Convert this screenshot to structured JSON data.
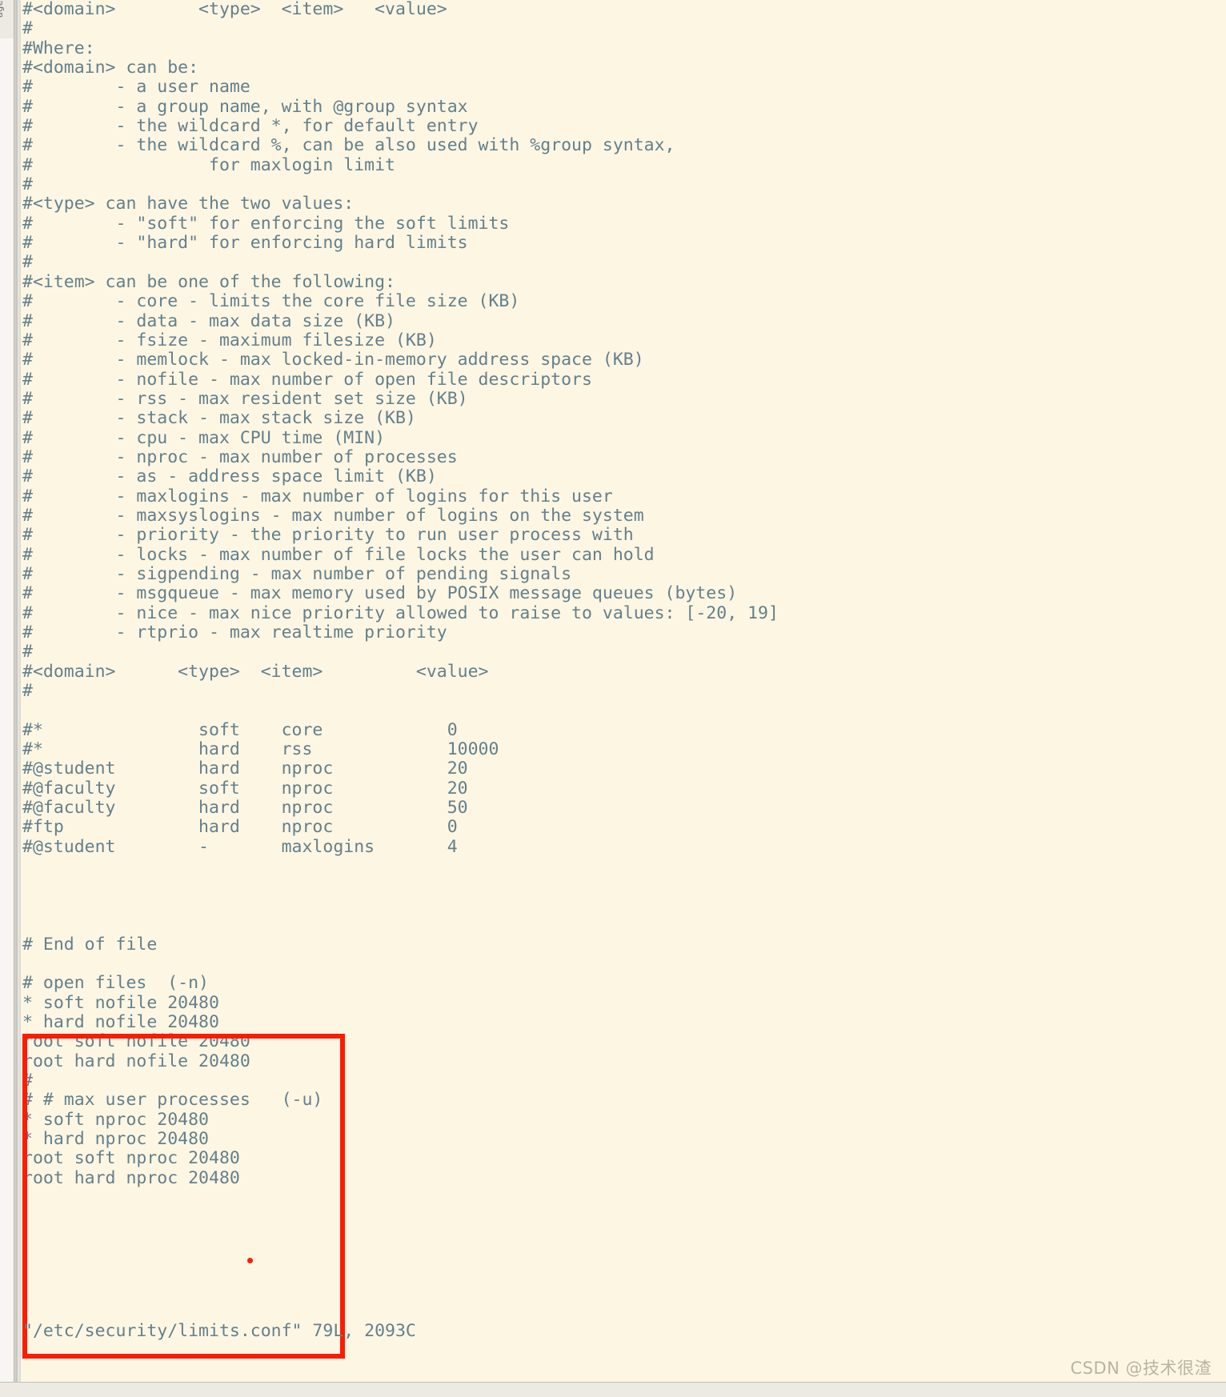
{
  "window": {
    "side_tab_label": "ager"
  },
  "editor": {
    "kind": "vim",
    "colors": {
      "background": "#fdf6e3",
      "foreground": "#63808c",
      "annotation": "#ff1b00",
      "chrome": "#eceae3",
      "watermark": "#b9b3a4"
    },
    "file_content": "#<domain>        <type>  <item>   <value>\n#\n#Where:\n#<domain> can be:\n#        - a user name\n#        - a group name, with @group syntax\n#        - the wildcard *, for default entry\n#        - the wildcard %, can be also used with %group syntax,\n#                 for maxlogin limit\n#\n#<type> can have the two values:\n#        - \"soft\" for enforcing the soft limits\n#        - \"hard\" for enforcing hard limits\n#\n#<item> can be one of the following:\n#        - core - limits the core file size (KB)\n#        - data - max data size (KB)\n#        - fsize - maximum filesize (KB)\n#        - memlock - max locked-in-memory address space (KB)\n#        - nofile - max number of open file descriptors\n#        - rss - max resident set size (KB)\n#        - stack - max stack size (KB)\n#        - cpu - max CPU time (MIN)\n#        - nproc - max number of processes\n#        - as - address space limit (KB)\n#        - maxlogins - max number of logins for this user\n#        - maxsyslogins - max number of logins on the system\n#        - priority - the priority to run user process with\n#        - locks - max number of file locks the user can hold\n#        - sigpending - max number of pending signals\n#        - msgqueue - max memory used by POSIX message queues (bytes)\n#        - nice - max nice priority allowed to raise to values: [-20, 19]\n#        - rtprio - max realtime priority\n#\n#<domain>      <type>  <item>         <value>\n#\n\n#*               soft    core            0\n#*               hard    rss             10000\n#@student        hard    nproc           20\n#@faculty        soft    nproc           20\n#@faculty        hard    nproc           50\n#ftp             hard    nproc           0\n#@student        -       maxlogins       4\n\n\n\n\n# End of file\n\n# open files  (-n)\n* soft nofile 20480\n* hard nofile 20480\nroot soft nofile 20480\nroot hard nofile 20480\n#\n# # max user processes   (-u)\n* soft nproc 20480\n* hard nproc 20480\nroot soft nproc 20480\nroot hard nproc 20480",
    "status_line": "\"/etc/security/limits.conf\" 79L, 2093C",
    "file_path": "/etc/security/limits.conf",
    "line_count": "79L",
    "char_count": "2093C"
  },
  "annotation": {
    "label": "red-highlight-box",
    "highlighted_lines": [
      "# End of file",
      "# open files  (-n)",
      "* soft nofile 20480",
      "* hard nofile 20480",
      "root soft nofile 20480",
      "root hard nofile 20480",
      "#",
      "# # max user processes   (-u)",
      "* soft nproc 20480",
      "* hard nproc 20480",
      "root soft nproc 20480",
      "root hard nproc 20480"
    ]
  },
  "watermark": {
    "text": "CSDN @技术很渣"
  }
}
